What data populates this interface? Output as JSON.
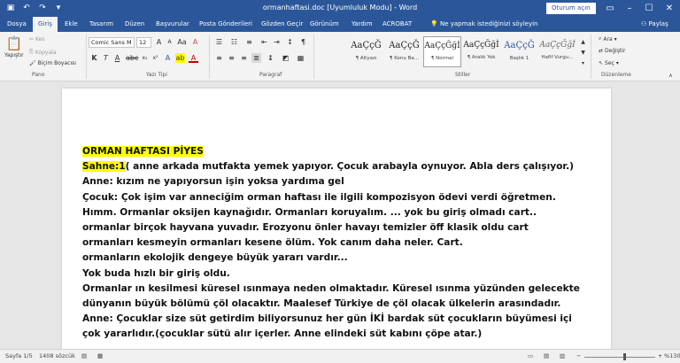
{
  "window": {
    "title": "ormanhaftasi.doc [Uyumluluk Modu] - Word",
    "signin_label": "Oturum açın",
    "qat_icons": [
      "save-icon",
      "undo-icon",
      "redo-icon",
      "customize-icon"
    ]
  },
  "tabs": [
    {
      "label": "Dosya"
    },
    {
      "label": "Giriş",
      "active": true
    },
    {
      "label": "Ekle"
    },
    {
      "label": "Tasarım"
    },
    {
      "label": "Düzen"
    },
    {
      "label": "Başvurular"
    },
    {
      "label": "Posta Gönderileri"
    },
    {
      "label": "Gözden Geçir"
    },
    {
      "label": "Görünüm"
    },
    {
      "label": "Yardım"
    },
    {
      "label": "ACROBAT"
    }
  ],
  "tell_me": "Ne yapmak istediğinizi söyleyin",
  "share_label": "Paylaş",
  "clipboard": {
    "paste": "Yapıştır",
    "cut": "Kes",
    "copy": "Kopyala",
    "format_painter": "Biçim Boyacısı",
    "group": "Pano"
  },
  "font": {
    "name": "Comic Sans M",
    "size": "12",
    "group": "Yazı Tipi"
  },
  "paragraph": {
    "group": "Paragraf"
  },
  "styles": {
    "items": [
      {
        "sample": "AaÇçĞ",
        "name": "¶ Altyazı"
      },
      {
        "sample": "AaÇçĞ",
        "name": "¶ Konu Ba..."
      },
      {
        "sample": "AaÇçĞğİ",
        "name": "¶ Normal",
        "selected": true
      },
      {
        "sample": "AaÇçĞğİ",
        "name": "¶ Aralık Yok"
      },
      {
        "sample": "AaÇçĞ",
        "name": "Başlık 1"
      },
      {
        "sample": "AaÇçĞğİ",
        "name": "Hafif Vurgu..."
      }
    ],
    "group": "Stiller"
  },
  "editing": {
    "find": "Ara",
    "replace": "Değiştir",
    "select": "Seç",
    "group": "Düzenleme"
  },
  "document": {
    "title": "ORMAN HAFTASI PİYES",
    "scene_label": "Sahne:1",
    "scene_text": "( anne arkada mutfakta yemek yapıyor. Çocuk arabayla oynuyor. Abla ders çalışıyor.)",
    "lines": [
      "Anne: kızım ne yapıyorsun işin yoksa yardıma gel",
      "Çocuk: Çok işim var anneciğim orman haftası ile ilgili kompozisyon ödevi verdi öğretmen.",
      "Hımm. Ormanlar oksijen kaynağıdır. Ormanları koruyalım. ... yok bu giriş olmadı cart..",
      "ormanlar birçok hayvana yuvadır. Erozyonu önler havayı temizler öff klasik oldu cart",
      "ormanları kesmeyin ormanları kesene ölüm.  Yok canım daha neler. Cart.",
      "ormanların ekolojik dengeye büyük yararı vardır...",
      "Yok buda hızlı bir giriş oldu.",
      "Ormanlar ın kesilmesi küresel ısınmaya neden olmaktadır. Küresel ısınma yüzünden gelecekte",
      "dünyanın büyük bölümü çöl olacaktır. Maalesef Türkiye de çöl olacak ülkelerin arasındadır.",
      "Anne: Çocuklar size süt getirdim biliyorsunuz her gün İKİ bardak süt çocukların büyümesi içi",
      "çok yararlıdır.(çocuklar sütü alır  içerler. Anne elindeki süt kabını çöpe atar.)"
    ]
  },
  "status": {
    "page": "Sayfa 1/5",
    "words": "1408 sözcük",
    "zoom": "%130"
  },
  "colors": {
    "accent": "#2b579a",
    "highlight": "#ffff00"
  }
}
